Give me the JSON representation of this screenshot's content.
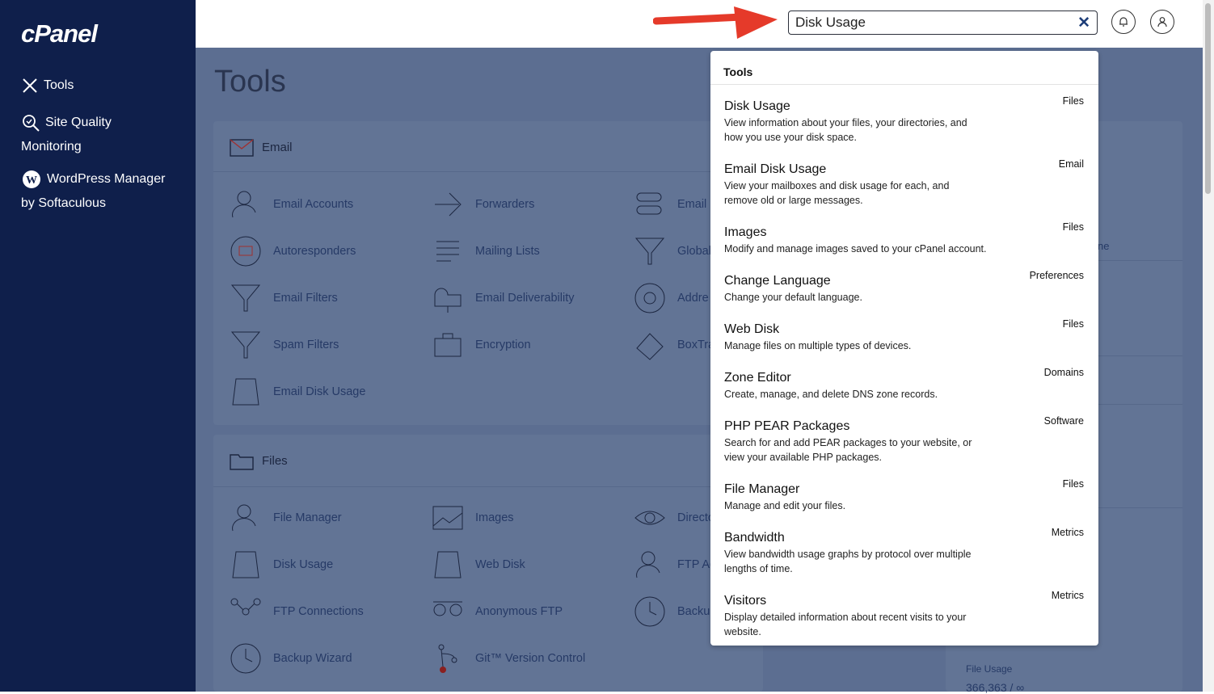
{
  "sidebar": {
    "logo": "cPanel",
    "items": [
      {
        "label": "Tools"
      },
      {
        "label_line1": "Site Quality",
        "label_line2": "Monitoring"
      },
      {
        "label_line1": "WordPress Manager",
        "label_line2": "by Softaculous"
      }
    ]
  },
  "search": {
    "value": "Disk Usage",
    "clear": "✕"
  },
  "page": {
    "title": "Tools"
  },
  "sections": [
    {
      "title": "Email",
      "tools": [
        "Email Accounts",
        "Forwarders",
        "Email",
        "Autoresponders",
        "Mailing Lists",
        "Global",
        "Email Filters",
        "Email Deliverability",
        "Addre",
        "Spam Filters",
        "Encryption",
        "BoxTra",
        "Email Disk Usage"
      ]
    },
    {
      "title": "Files",
      "tools": [
        "File Manager",
        "Images",
        "Directo",
        "Disk Usage",
        "Web Disk",
        "FTP Ac",
        "FTP Connections",
        "Anonymous FTP",
        "Backu",
        "Backup Wizard",
        "Git™ Version Control"
      ]
    }
  ],
  "right_panel": {
    "file_usage_label": "File Usage",
    "file_usage_value": "366,363 / ∞",
    "link_fragment": "ne"
  },
  "dropdown": {
    "heading": "Tools",
    "results": [
      {
        "title": "Disk Usage",
        "desc": "View information about your files, your directories, and how you use your disk space.",
        "category": "Files"
      },
      {
        "title": "Email Disk Usage",
        "desc": "View your mailboxes and disk usage for each, and remove old or large messages.",
        "category": "Email"
      },
      {
        "title": "Images",
        "desc": "Modify and manage images saved to your cPanel account.",
        "category": "Files"
      },
      {
        "title": "Change Language",
        "desc": "Change your default language.",
        "category": "Preferences"
      },
      {
        "title": "Web Disk",
        "desc": "Manage files on multiple types of devices.",
        "category": "Files"
      },
      {
        "title": "Zone Editor",
        "desc": "Create, manage, and delete DNS zone records.",
        "category": "Domains"
      },
      {
        "title": "PHP PEAR Packages",
        "desc": "Search for and add PEAR packages to your website, or view your available PHP packages.",
        "category": "Software"
      },
      {
        "title": "File Manager",
        "desc": "Manage and edit your files.",
        "category": "Files"
      },
      {
        "title": "Bandwidth",
        "desc": "View bandwidth usage graphs by protocol over multiple lengths of time.",
        "category": "Metrics"
      },
      {
        "title": "Visitors",
        "desc": "Display detailed information about recent visits to your website.",
        "category": "Metrics"
      }
    ]
  },
  "colors": {
    "sidebar": "#0f1f4b",
    "overlay": "#5c6e91",
    "arrow": "#e53a2a"
  }
}
